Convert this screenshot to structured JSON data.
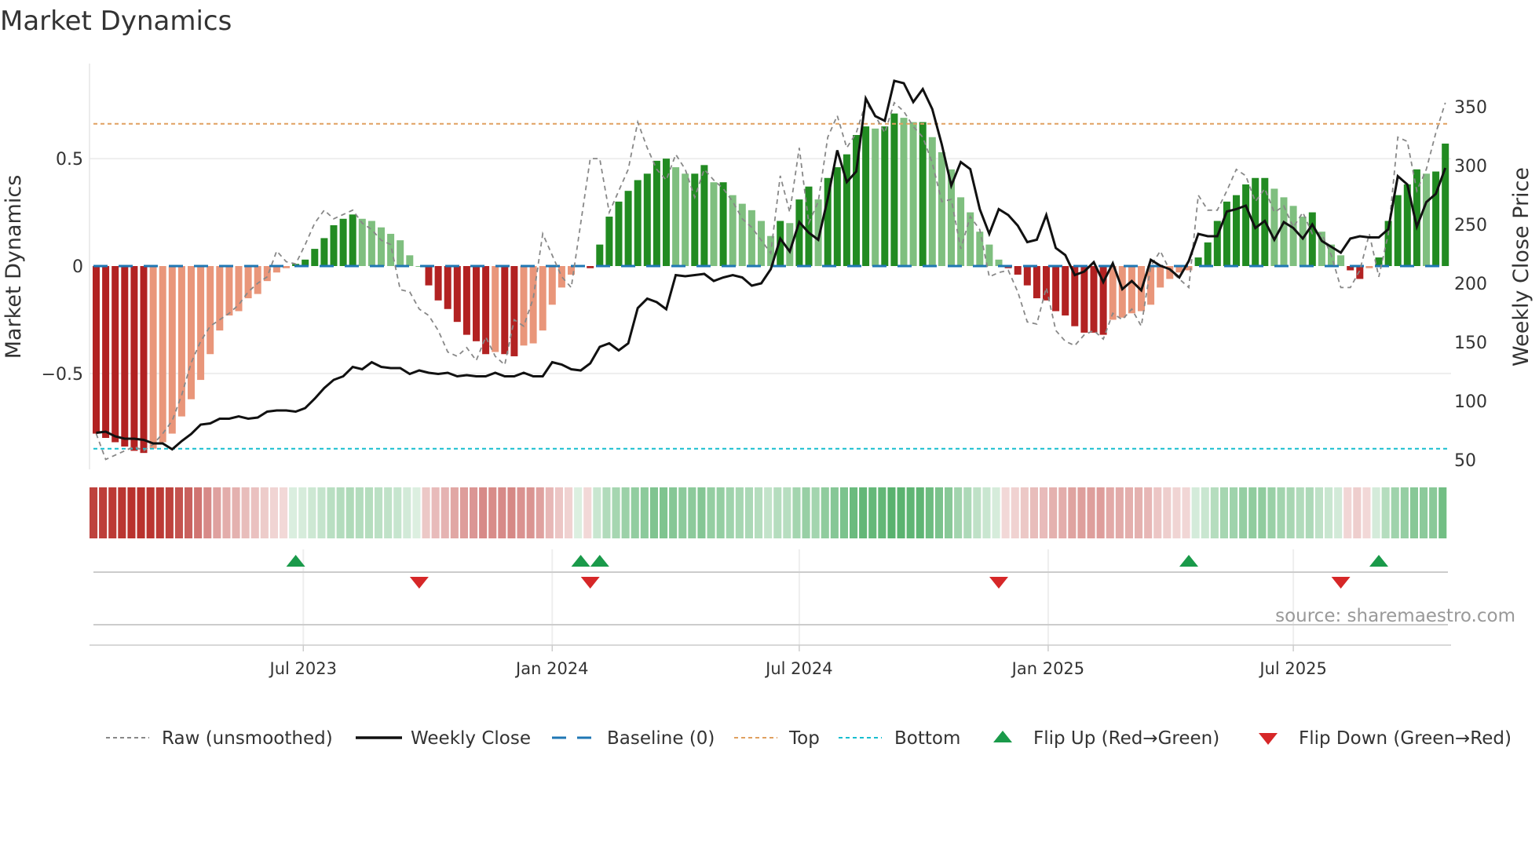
{
  "title": "Market Dynamics",
  "source": "source: sharemaestro.com",
  "colors": {
    "dark_red": "#b22222",
    "light_red": "#e9967a",
    "dark_green": "#228b22",
    "light_green": "#7fbf7f",
    "baseline": "#1f77b4",
    "top": "#e0a060",
    "bottom": "#17becf",
    "raw": "#888888",
    "close": "#111111",
    "flip_up": "#1a9a4a",
    "flip_down": "#d62728"
  },
  "chart_data": {
    "type": "bar",
    "title": "Market Dynamics",
    "ylabel": "Market Dynamics",
    "y2label": "Weekly Close Price",
    "ylim": [
      -0.95,
      0.95
    ],
    "y2lim": [
      40,
      378
    ],
    "yticks": [
      {
        "v": 0.5,
        "label": "0.5"
      },
      {
        "v": 0,
        "label": "0"
      },
      {
        "v": -0.5,
        "label": "−0.5"
      }
    ],
    "y2ticks": [
      {
        "v": 350,
        "label": "350"
      },
      {
        "v": 300,
        "label": "300"
      },
      {
        "v": 250,
        "label": "250"
      },
      {
        "v": 200,
        "label": "200"
      },
      {
        "v": 150,
        "label": "150"
      },
      {
        "v": 100,
        "label": "100"
      },
      {
        "v": 50,
        "label": "50"
      }
    ],
    "xticks": [
      {
        "week": 21.8,
        "label": "Jul 2023"
      },
      {
        "week": 48,
        "label": "Jan 2024"
      },
      {
        "week": 74,
        "label": "Jul 2024"
      },
      {
        "week": 100.2,
        "label": "Jan 2025"
      },
      {
        "week": 126,
        "label": "Jul 2025"
      }
    ],
    "top_level": 0.662,
    "bottom_level": -0.85,
    "baseline": 0,
    "oscillator": [
      -0.78,
      -0.8,
      -0.82,
      -0.84,
      -0.86,
      -0.87,
      -0.85,
      -0.82,
      -0.78,
      -0.7,
      -0.62,
      -0.53,
      -0.41,
      -0.3,
      -0.23,
      -0.21,
      -0.15,
      -0.13,
      -0.07,
      -0.03,
      -0.01,
      0.01,
      0.03,
      0.08,
      0.13,
      0.19,
      0.22,
      0.24,
      0.22,
      0.21,
      0.18,
      0.15,
      0.12,
      0.05,
      0.0,
      -0.09,
      -0.16,
      -0.2,
      -0.26,
      -0.32,
      -0.35,
      -0.41,
      -0.4,
      -0.41,
      -0.42,
      -0.37,
      -0.36,
      -0.3,
      -0.18,
      -0.1,
      -0.04,
      0.005,
      -0.01,
      0.1,
      0.23,
      0.3,
      0.35,
      0.4,
      0.43,
      0.49,
      0.5,
      0.46,
      0.43,
      0.43,
      0.47,
      0.39,
      0.39,
      0.33,
      0.29,
      0.26,
      0.21,
      0.14,
      0.21,
      0.2,
      0.31,
      0.37,
      0.31,
      0.41,
      0.46,
      0.52,
      0.61,
      0.65,
      0.64,
      0.65,
      0.71,
      0.69,
      0.67,
      0.67,
      0.6,
      0.53,
      0.45,
      0.32,
      0.25,
      0.16,
      0.1,
      0.03,
      -0.01,
      -0.04,
      -0.09,
      -0.15,
      -0.16,
      -0.21,
      -0.23,
      -0.28,
      -0.31,
      -0.31,
      -0.32,
      -0.25,
      -0.24,
      -0.22,
      -0.21,
      -0.18,
      -0.1,
      -0.06,
      -0.03,
      -0.02,
      0.04,
      0.11,
      0.21,
      0.3,
      0.33,
      0.38,
      0.41,
      0.41,
      0.36,
      0.32,
      0.28,
      0.23,
      0.25,
      0.16,
      0.1,
      0.05,
      -0.02,
      -0.06,
      -0.01,
      0.04,
      0.21,
      0.33,
      0.38,
      0.45,
      0.43,
      0.44,
      0.57
    ],
    "raw": [
      -0.78,
      -0.9,
      -0.88,
      -0.86,
      -0.84,
      -0.86,
      -0.83,
      -0.78,
      -0.72,
      -0.6,
      -0.45,
      -0.35,
      -0.28,
      -0.25,
      -0.22,
      -0.18,
      -0.12,
      -0.08,
      -0.05,
      0.07,
      0.02,
      0.01,
      0.1,
      0.2,
      0.26,
      0.22,
      0.24,
      0.26,
      0.2,
      0.17,
      0.12,
      0.1,
      -0.11,
      -0.12,
      -0.2,
      -0.23,
      -0.3,
      -0.4,
      -0.42,
      -0.38,
      -0.44,
      -0.33,
      -0.42,
      -0.46,
      -0.25,
      -0.28,
      -0.15,
      0.15,
      0.05,
      -0.05,
      -0.1,
      0.2,
      0.5,
      0.5,
      0.25,
      0.35,
      0.45,
      0.67,
      0.55,
      0.45,
      0.4,
      0.52,
      0.45,
      0.32,
      0.45,
      0.4,
      0.36,
      0.3,
      0.22,
      0.18,
      0.12,
      0.06,
      0.42,
      0.25,
      0.55,
      0.2,
      0.3,
      0.6,
      0.7,
      0.55,
      0.62,
      0.76,
      0.7,
      0.62,
      0.76,
      0.72,
      0.65,
      0.6,
      0.48,
      0.3,
      0.31,
      0.08,
      0.23,
      0.17,
      -0.05,
      -0.03,
      -0.02,
      -0.12,
      -0.26,
      -0.27,
      -0.1,
      -0.3,
      -0.35,
      -0.37,
      -0.32,
      -0.3,
      -0.34,
      -0.22,
      -0.25,
      -0.2,
      -0.28,
      0.0,
      0.07,
      -0.02,
      -0.06,
      -0.1,
      0.33,
      0.26,
      0.26,
      0.35,
      0.45,
      0.42,
      0.3,
      0.36,
      0.25,
      0.28,
      0.18,
      0.25,
      0.15,
      0.15,
      0.05,
      -0.1,
      -0.1,
      -0.02,
      0.15,
      -0.05,
      0.15,
      0.6,
      0.58,
      0.35,
      0.45,
      0.62,
      0.76
    ],
    "close": [
      73,
      74,
      70,
      68,
      68,
      67,
      64,
      64,
      59,
      66,
      72,
      80,
      81,
      85,
      85,
      87,
      85,
      86,
      91,
      92,
      92,
      91,
      94,
      102,
      111,
      118,
      121,
      129,
      127,
      133,
      129,
      128,
      128,
      123,
      126,
      124,
      123,
      124,
      121,
      122,
      121,
      121,
      124,
      121,
      121,
      124,
      121,
      121,
      133,
      131,
      127,
      126,
      132,
      146,
      149,
      143,
      149,
      179,
      187,
      184,
      178,
      207,
      206,
      207,
      208,
      202,
      205,
      207,
      205,
      198,
      200,
      212,
      238,
      227,
      252,
      243,
      237,
      272,
      313,
      286,
      295,
      357,
      342,
      338,
      372,
      370,
      354,
      365,
      348,
      318,
      283,
      303,
      297,
      263,
      242,
      263,
      258,
      249,
      235,
      237,
      258,
      230,
      224,
      207,
      210,
      218,
      201,
      217,
      195,
      202,
      194,
      220,
      215,
      212,
      205,
      219,
      242,
      240,
      240,
      261,
      263,
      266,
      247,
      253,
      237,
      252,
      247,
      238,
      250,
      236,
      231,
      226,
      238,
      240,
      239,
      239,
      246,
      291,
      284,
      248,
      269,
      276,
      298
    ],
    "flip_up_weeks": [
      21,
      51,
      53,
      115,
      135
    ],
    "flip_down_weeks": [
      34,
      52,
      95,
      131
    ],
    "legend": {
      "placement": "bottom",
      "raw": "Raw (unsmoothed)",
      "close": "Weekly Close",
      "baseline": "Baseline (0)",
      "top": "Top",
      "bottom": "Bottom",
      "flip_up": "Flip Up (Red→Green)",
      "flip_down": "Flip Down (Green→Red)"
    }
  }
}
